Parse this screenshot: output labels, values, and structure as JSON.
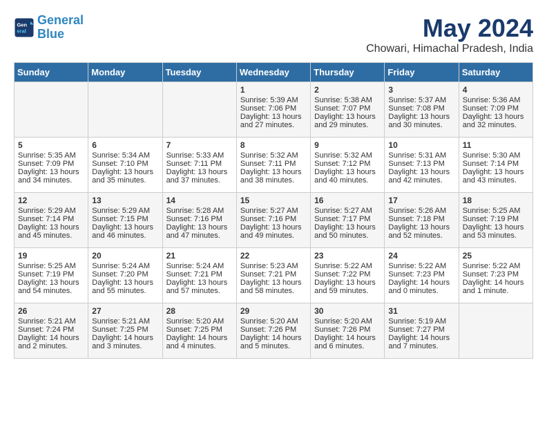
{
  "header": {
    "logo_line1": "General",
    "logo_line2": "Blue",
    "title": "May 2024",
    "location": "Chowari, Himachal Pradesh, India"
  },
  "weekdays": [
    "Sunday",
    "Monday",
    "Tuesday",
    "Wednesday",
    "Thursday",
    "Friday",
    "Saturday"
  ],
  "weeks": [
    [
      {
        "day": "",
        "sunrise": "",
        "sunset": "",
        "daylight": ""
      },
      {
        "day": "",
        "sunrise": "",
        "sunset": "",
        "daylight": ""
      },
      {
        "day": "",
        "sunrise": "",
        "sunset": "",
        "daylight": ""
      },
      {
        "day": "1",
        "sunrise": "Sunrise: 5:39 AM",
        "sunset": "Sunset: 7:06 PM",
        "daylight": "Daylight: 13 hours and 27 minutes."
      },
      {
        "day": "2",
        "sunrise": "Sunrise: 5:38 AM",
        "sunset": "Sunset: 7:07 PM",
        "daylight": "Daylight: 13 hours and 29 minutes."
      },
      {
        "day": "3",
        "sunrise": "Sunrise: 5:37 AM",
        "sunset": "Sunset: 7:08 PM",
        "daylight": "Daylight: 13 hours and 30 minutes."
      },
      {
        "day": "4",
        "sunrise": "Sunrise: 5:36 AM",
        "sunset": "Sunset: 7:09 PM",
        "daylight": "Daylight: 13 hours and 32 minutes."
      }
    ],
    [
      {
        "day": "5",
        "sunrise": "Sunrise: 5:35 AM",
        "sunset": "Sunset: 7:09 PM",
        "daylight": "Daylight: 13 hours and 34 minutes."
      },
      {
        "day": "6",
        "sunrise": "Sunrise: 5:34 AM",
        "sunset": "Sunset: 7:10 PM",
        "daylight": "Daylight: 13 hours and 35 minutes."
      },
      {
        "day": "7",
        "sunrise": "Sunrise: 5:33 AM",
        "sunset": "Sunset: 7:11 PM",
        "daylight": "Daylight: 13 hours and 37 minutes."
      },
      {
        "day": "8",
        "sunrise": "Sunrise: 5:32 AM",
        "sunset": "Sunset: 7:11 PM",
        "daylight": "Daylight: 13 hours and 38 minutes."
      },
      {
        "day": "9",
        "sunrise": "Sunrise: 5:32 AM",
        "sunset": "Sunset: 7:12 PM",
        "daylight": "Daylight: 13 hours and 40 minutes."
      },
      {
        "day": "10",
        "sunrise": "Sunrise: 5:31 AM",
        "sunset": "Sunset: 7:13 PM",
        "daylight": "Daylight: 13 hours and 42 minutes."
      },
      {
        "day": "11",
        "sunrise": "Sunrise: 5:30 AM",
        "sunset": "Sunset: 7:14 PM",
        "daylight": "Daylight: 13 hours and 43 minutes."
      }
    ],
    [
      {
        "day": "12",
        "sunrise": "Sunrise: 5:29 AM",
        "sunset": "Sunset: 7:14 PM",
        "daylight": "Daylight: 13 hours and 45 minutes."
      },
      {
        "day": "13",
        "sunrise": "Sunrise: 5:29 AM",
        "sunset": "Sunset: 7:15 PM",
        "daylight": "Daylight: 13 hours and 46 minutes."
      },
      {
        "day": "14",
        "sunrise": "Sunrise: 5:28 AM",
        "sunset": "Sunset: 7:16 PM",
        "daylight": "Daylight: 13 hours and 47 minutes."
      },
      {
        "day": "15",
        "sunrise": "Sunrise: 5:27 AM",
        "sunset": "Sunset: 7:16 PM",
        "daylight": "Daylight: 13 hours and 49 minutes."
      },
      {
        "day": "16",
        "sunrise": "Sunrise: 5:27 AM",
        "sunset": "Sunset: 7:17 PM",
        "daylight": "Daylight: 13 hours and 50 minutes."
      },
      {
        "day": "17",
        "sunrise": "Sunrise: 5:26 AM",
        "sunset": "Sunset: 7:18 PM",
        "daylight": "Daylight: 13 hours and 52 minutes."
      },
      {
        "day": "18",
        "sunrise": "Sunrise: 5:25 AM",
        "sunset": "Sunset: 7:19 PM",
        "daylight": "Daylight: 13 hours and 53 minutes."
      }
    ],
    [
      {
        "day": "19",
        "sunrise": "Sunrise: 5:25 AM",
        "sunset": "Sunset: 7:19 PM",
        "daylight": "Daylight: 13 hours and 54 minutes."
      },
      {
        "day": "20",
        "sunrise": "Sunrise: 5:24 AM",
        "sunset": "Sunset: 7:20 PM",
        "daylight": "Daylight: 13 hours and 55 minutes."
      },
      {
        "day": "21",
        "sunrise": "Sunrise: 5:24 AM",
        "sunset": "Sunset: 7:21 PM",
        "daylight": "Daylight: 13 hours and 57 minutes."
      },
      {
        "day": "22",
        "sunrise": "Sunrise: 5:23 AM",
        "sunset": "Sunset: 7:21 PM",
        "daylight": "Daylight: 13 hours and 58 minutes."
      },
      {
        "day": "23",
        "sunrise": "Sunrise: 5:22 AM",
        "sunset": "Sunset: 7:22 PM",
        "daylight": "Daylight: 13 hours and 59 minutes."
      },
      {
        "day": "24",
        "sunrise": "Sunrise: 5:22 AM",
        "sunset": "Sunset: 7:23 PM",
        "daylight": "Daylight: 14 hours and 0 minutes."
      },
      {
        "day": "25",
        "sunrise": "Sunrise: 5:22 AM",
        "sunset": "Sunset: 7:23 PM",
        "daylight": "Daylight: 14 hours and 1 minute."
      }
    ],
    [
      {
        "day": "26",
        "sunrise": "Sunrise: 5:21 AM",
        "sunset": "Sunset: 7:24 PM",
        "daylight": "Daylight: 14 hours and 2 minutes."
      },
      {
        "day": "27",
        "sunrise": "Sunrise: 5:21 AM",
        "sunset": "Sunset: 7:25 PM",
        "daylight": "Daylight: 14 hours and 3 minutes."
      },
      {
        "day": "28",
        "sunrise": "Sunrise: 5:20 AM",
        "sunset": "Sunset: 7:25 PM",
        "daylight": "Daylight: 14 hours and 4 minutes."
      },
      {
        "day": "29",
        "sunrise": "Sunrise: 5:20 AM",
        "sunset": "Sunset: 7:26 PM",
        "daylight": "Daylight: 14 hours and 5 minutes."
      },
      {
        "day": "30",
        "sunrise": "Sunrise: 5:20 AM",
        "sunset": "Sunset: 7:26 PM",
        "daylight": "Daylight: 14 hours and 6 minutes."
      },
      {
        "day": "31",
        "sunrise": "Sunrise: 5:19 AM",
        "sunset": "Sunset: 7:27 PM",
        "daylight": "Daylight: 14 hours and 7 minutes."
      },
      {
        "day": "",
        "sunrise": "",
        "sunset": "",
        "daylight": ""
      }
    ]
  ]
}
